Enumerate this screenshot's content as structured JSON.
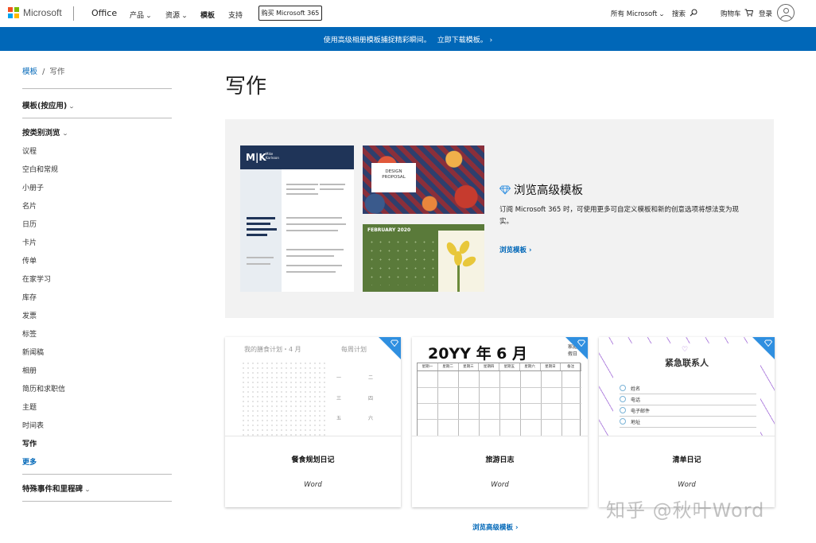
{
  "header": {
    "logo_text": "Microsoft",
    "brand": "Office",
    "nav": [
      "产品",
      "资源",
      "模板",
      "支持"
    ],
    "buy_button": "购买 Microsoft 365",
    "all_microsoft": "所有 Microsoft",
    "search": "搜索",
    "cart": "购物车",
    "signin": "登录"
  },
  "banner": {
    "text": "使用高级相册模板捕捉精彩瞬间。",
    "cta": "立即下载模板。"
  },
  "sidebar": {
    "breadcrumb_root": "模板",
    "breadcrumb_current": "写作",
    "by_app": "模板(按应用)",
    "browse_by_category": "按类别浏览",
    "categories": [
      "议程",
      "空白和常规",
      "小册子",
      "名片",
      "日历",
      "卡片",
      "传单",
      "在家学习",
      "库存",
      "发票",
      "标签",
      "新闻稿",
      "相册",
      "简历和求职信",
      "主题",
      "时间表",
      "写作"
    ],
    "more": "更多",
    "special_events": "特殊事件和里程碑"
  },
  "main": {
    "title": "写作",
    "promo": {
      "title": "浏览高级模板",
      "description": "订阅 Microsoft 365 时，可使用更多可自定义模板和新的创意选项将想法变为现实。",
      "link": "浏览模板"
    },
    "preview_texts": {
      "resume_initials": "M|K",
      "resume_name": "Mike\nKarlsson",
      "design_card": "DESIGN\nPROPOSAL",
      "calendar_month": "FEBRUARY 2020"
    },
    "cards": [
      {
        "title": "餐食规划日记",
        "app": "Word",
        "thumb_title": "我的膳食计划・4 月",
        "thumb_right": "每周计划"
      },
      {
        "title": "旅游日志",
        "app": "Word",
        "thumb_title": "20YY 年 6 月",
        "thumb_corner": "家庭\n假日",
        "week": [
          "星期一",
          "星期二",
          "星期三",
          "星期四",
          "星期五",
          "星期六",
          "星期日",
          "备注"
        ]
      },
      {
        "title": "清单日记",
        "app": "Word",
        "thumb_title": "紧急联系人",
        "fields": [
          "姓名",
          "电话",
          "电子邮件",
          "地址"
        ]
      }
    ],
    "bottom_link": "浏览高级模板"
  },
  "watermark": "知乎 @秋叶Word",
  "colors": {
    "accent": "#0067b8",
    "badge": "#2f8fe0"
  }
}
